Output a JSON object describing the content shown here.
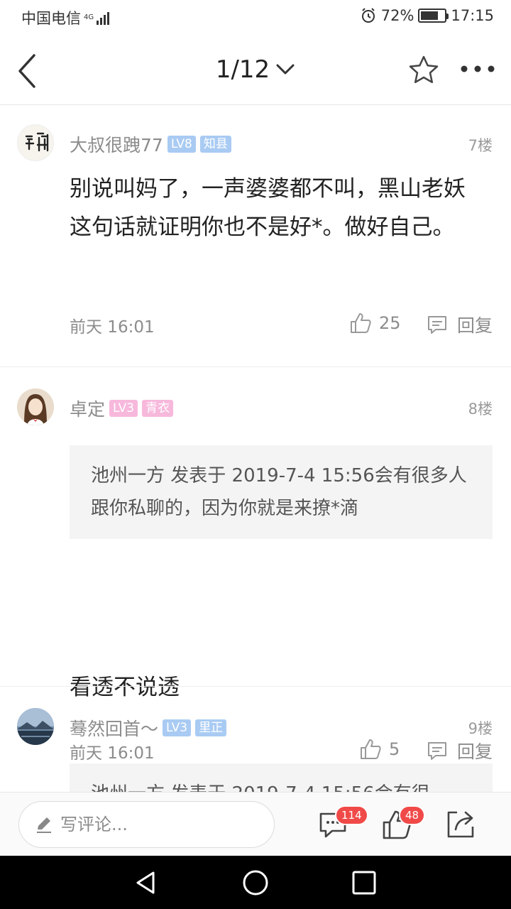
{
  "status_bar": {
    "carrier": "中国电信",
    "network": "4G",
    "battery_percent": "72%",
    "battery_level": 0.72,
    "time": "17:15"
  },
  "nav": {
    "page_indicator": "1/12",
    "icons": [
      "back-icon",
      "chevron-down-icon",
      "star-icon",
      "more-icon"
    ]
  },
  "posts": [
    {
      "username": "大叔很跩77",
      "level": "LV8",
      "title": "知县",
      "badge_color": "#a9cbf3",
      "floor": "7楼",
      "content": "别说叫妈了，一声婆婆都不叫，黑山老妖这句话就证明你也不是好*。做好自己。",
      "time": "前天 16:01",
      "likes": "25",
      "reply_label": "回复"
    },
    {
      "username": "卓定",
      "level": "LV3",
      "title": "青衣",
      "badge_color": "#f7b8dc",
      "floor": "8楼",
      "quote": "池州一方 发表于 2019-7-4 15:56会有很多人跟你私聊的，因为你就是来撩*滴",
      "content": "看透不说透",
      "time": "前天 16:01",
      "likes": "5",
      "reply_label": "回复"
    },
    {
      "username": "蓦然回首～",
      "level": "LV3",
      "title": "里正",
      "badge_color": "#a9cbf3",
      "floor": "9楼",
      "quote": "池州一方 发表于 2019-7-4 15:56会有很"
    }
  ],
  "bottom_bar": {
    "comment_placeholder": "写评论...",
    "comment_count": "114",
    "like_count": "48"
  },
  "colors": {
    "badge_red": "#f04a48",
    "text_gray": "#8c8c8c"
  }
}
